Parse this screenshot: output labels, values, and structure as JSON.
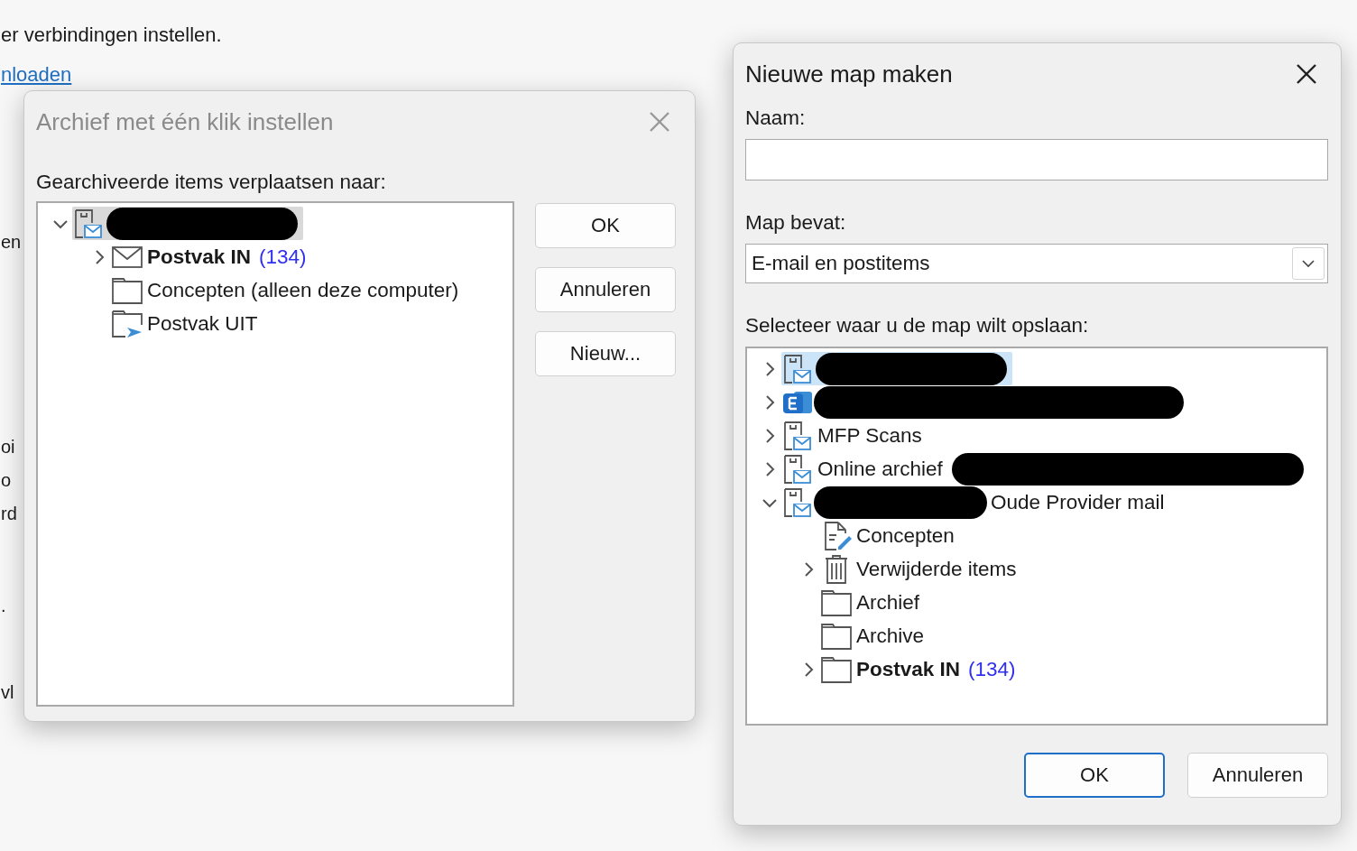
{
  "background_page": {
    "lines": [
      {
        "text": "er verbindingen instellen.",
        "kind": "text"
      },
      {
        "text": "nloaden",
        "kind": "link"
      },
      {
        "text": "en",
        "kind": "text"
      },
      {
        "text": "oi",
        "kind": "text"
      },
      {
        "text": "o",
        "kind": "text"
      },
      {
        "text": "rd",
        "kind": "text"
      },
      {
        "text": ".",
        "kind": "text"
      },
      {
        "text": "vl",
        "kind": "text"
      }
    ]
  },
  "archive_dialog": {
    "title": "Archief met één klik instellen",
    "active": false,
    "tree_label": "Gearchiveerde items verplaatsen naar:",
    "tree": [
      {
        "kind": "store",
        "expanded": true,
        "selected": true,
        "redacted_suffix": true,
        "children": [
          {
            "kind": "envelope",
            "label": "Postvak IN",
            "count": "(134)",
            "unread": true,
            "expanded": false,
            "selected": false
          },
          {
            "kind": "folder",
            "label": "Concepten (alleen deze computer)",
            "selected": false
          },
          {
            "kind": "outbox",
            "label": "Postvak UIT",
            "selected": false
          }
        ]
      }
    ],
    "buttons": [
      {
        "label": "OK",
        "default": false
      },
      {
        "label": "Annuleren",
        "default": false
      },
      {
        "label": "Nieuw...",
        "default": false
      }
    ]
  },
  "new_folder_dialog": {
    "title": "Nieuwe map maken",
    "active": true,
    "name_label": "Naam:",
    "contains_label": "Map bevat:",
    "contains_value": "E-mail en postitems",
    "tree_label": "Selecteer waar u de map wilt opslaan:",
    "tree": [
      {
        "kind": "store",
        "expanded": false,
        "selected": true,
        "redacted_suffix": true
      },
      {
        "kind": "exchange",
        "expanded": false,
        "selected": false,
        "redacted_suffix": true
      },
      {
        "kind": "store",
        "label": "MFP Scans",
        "expanded": false,
        "selected": false
      },
      {
        "kind": "store",
        "label": "Online archief",
        "expanded": false,
        "selected": false,
        "redacted_suffix": true
      },
      {
        "kind": "store",
        "label": "Oude Provider mail",
        "expanded": true,
        "selected": false,
        "redacted_prefix": true,
        "children": [
          {
            "kind": "draft",
            "label": "Concepten",
            "selected": false
          },
          {
            "kind": "trash",
            "label": "Verwijderde items",
            "expanded": false,
            "selected": false
          },
          {
            "kind": "folder",
            "label": "Archief",
            "selected": false
          },
          {
            "kind": "folder",
            "label": "Archive",
            "selected": false
          },
          {
            "kind": "folder",
            "label": "Postvak IN",
            "count": "(134)",
            "unread": true,
            "expanded": false,
            "selected": false
          }
        ]
      }
    ],
    "buttons": [
      {
        "label": "OK",
        "default": true
      },
      {
        "label": "Annuleren",
        "default": false
      }
    ]
  }
}
